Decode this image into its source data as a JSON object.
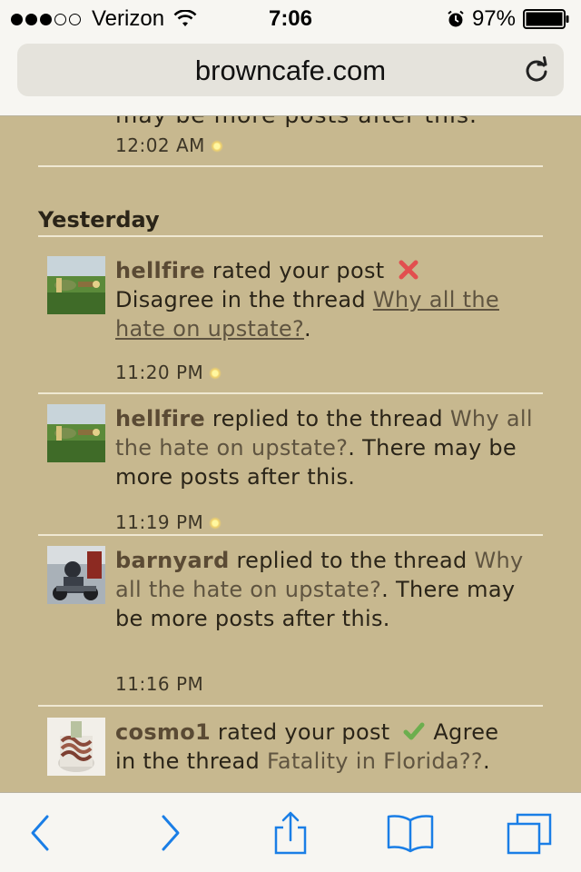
{
  "status_bar": {
    "carrier": "Verizon",
    "time": "7:06",
    "battery": "97%"
  },
  "address_bar": {
    "domain": "browncafe.com"
  },
  "feed": {
    "previous_tail": "may be more posts after this.",
    "previous_time": "12:02 AM",
    "section_title": "Yesterday",
    "items": [
      {
        "user": "hellfire",
        "action": " rated your post ",
        "rating": "Disagree",
        "middle": " in the thread ",
        "thread": "Why all the hate on upstate?",
        "suffix": ".",
        "time": "11:20 PM"
      },
      {
        "user": "hellfire",
        "action": " replied to the thread ",
        "thread": "Why all the hate on upstate?",
        "suffix": ". There may be more posts after this.",
        "time": "11:19 PM"
      },
      {
        "user": "barnyard",
        "action": " replied to the thread ",
        "thread": "Why all the hate on upstate?",
        "suffix": ". There may be more posts after this.",
        "time": "11:16 PM"
      },
      {
        "user": "cosmo1",
        "action": " rated your post ",
        "rating": "Agree",
        "middle": " in the thread ",
        "thread": "Fatality in Florida??",
        "suffix": "."
      }
    ]
  },
  "colors": {
    "page_background": "#c7b88f",
    "chrome_background": "#f7f6f2",
    "ios_blue": "#1a7ee6"
  },
  "icons": {
    "status": [
      "signal-dots-icon",
      "wifi-icon",
      "alarm-icon",
      "battery-icon"
    ],
    "address": "reload-icon",
    "toolbar": [
      "back-arrow-icon",
      "forward-arrow-icon",
      "share-icon",
      "bookmarks-icon",
      "tabs-icon"
    ]
  }
}
